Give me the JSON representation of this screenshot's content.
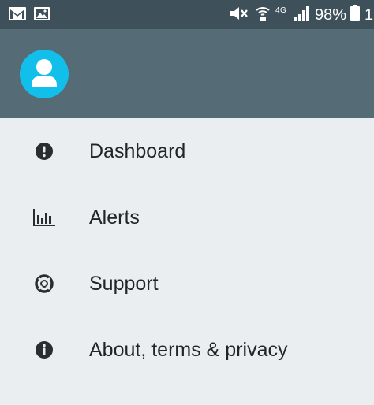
{
  "status_bar": {
    "left_icons": [
      "gmail-icon",
      "gallery-icon"
    ],
    "right_icons": [
      "mute-icon",
      "wifi-calling-icon",
      "lte-icon",
      "signal-icon"
    ],
    "network_label": "4G",
    "battery_percent": "98%",
    "clock": "1"
  },
  "header": {
    "avatar_icon": "user-icon",
    "avatar_color": "#12bfea",
    "background_color": "#556b75"
  },
  "menu": {
    "items": [
      {
        "label": "Dashboard",
        "icon": "exclamation-circle-icon"
      },
      {
        "label": "Alerts",
        "icon": "bar-chart-icon"
      },
      {
        "label": "Support",
        "icon": "life-ring-icon"
      },
      {
        "label": "About, terms & privacy",
        "icon": "info-circle-icon"
      }
    ]
  }
}
